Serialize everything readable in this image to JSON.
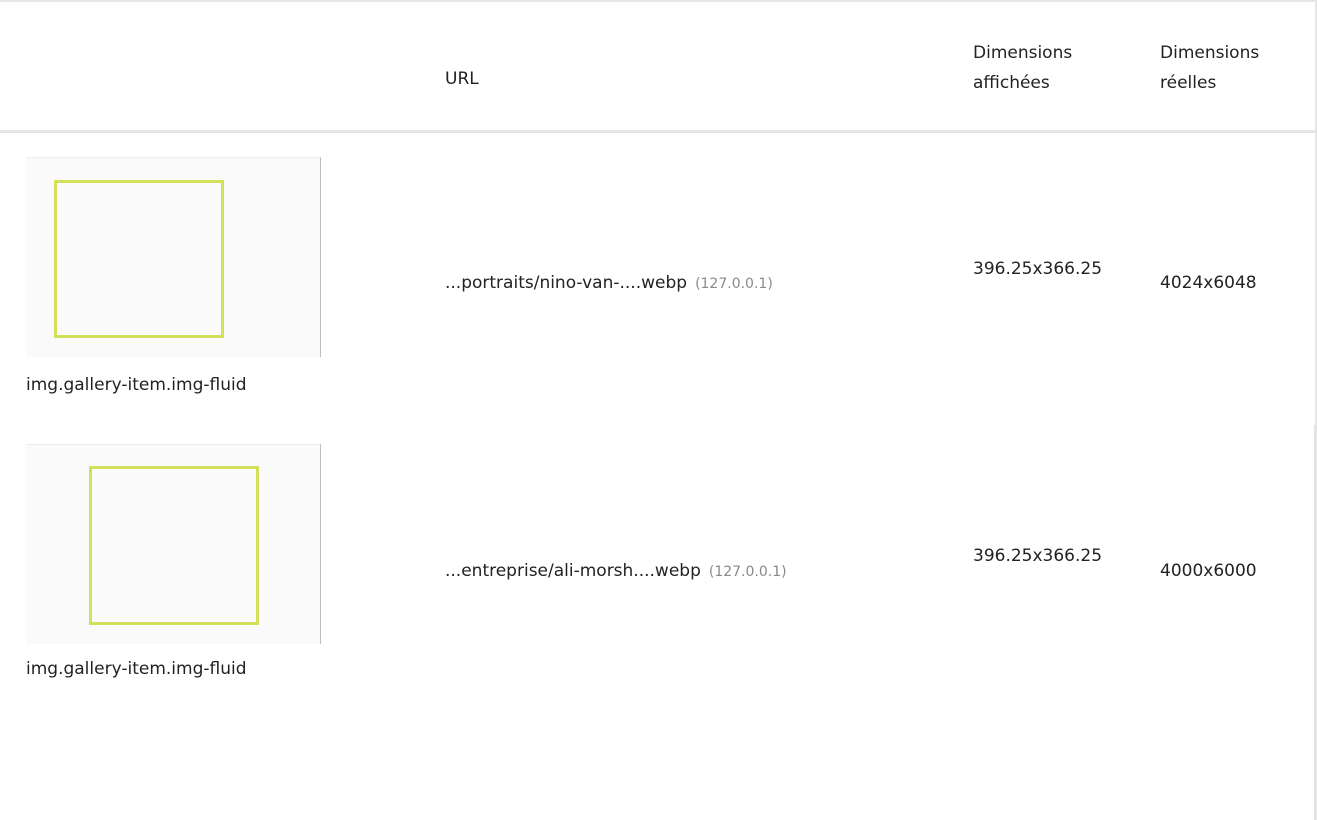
{
  "table": {
    "columns": {
      "thumbnail": "",
      "url": "URL",
      "displayed_dimensions": "Dimensions affichées",
      "real_dimensions": "Dimensions réelles"
    },
    "rows": [
      {
        "selector": "img.gallery-item.img-fluid",
        "url": "...portraits/nino-van-....webp",
        "host": "(127.0.0.1)",
        "displayed": "396.25x366.25",
        "real": "4024x6048"
      },
      {
        "selector": "img.gallery-item.img-fluid",
        "url": "...entreprise/ali-morsh....webp",
        "host": "(127.0.0.1)",
        "displayed": "396.25x366.25",
        "real": "4000x6000"
      }
    ]
  },
  "colors": {
    "thumbnail_outline": "#d2e05a",
    "host_text": "#8a8a8a",
    "divider": "#e5e5e5"
  }
}
